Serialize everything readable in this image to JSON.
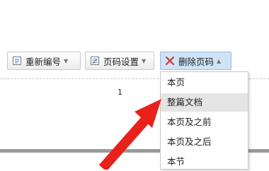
{
  "toolbar": {
    "renumber_label": "重新编号",
    "renumber_icon": "renumber-icon",
    "page_settings_label": "页码设置",
    "page_settings_icon": "page-settings-icon",
    "delete_page_label": "删除页码",
    "delete_page_icon": "red-x-icon",
    "accent_color": "#d9302b"
  },
  "page": {
    "number": "1"
  },
  "delete_menu": {
    "items": [
      {
        "label": "本页"
      },
      {
        "label": "整篇文档",
        "highlighted": true
      },
      {
        "label": "本页及之前"
      },
      {
        "label": "本页及之后"
      },
      {
        "label": "本节"
      }
    ]
  },
  "annotation": {
    "arrow_color": "#e8221b"
  }
}
